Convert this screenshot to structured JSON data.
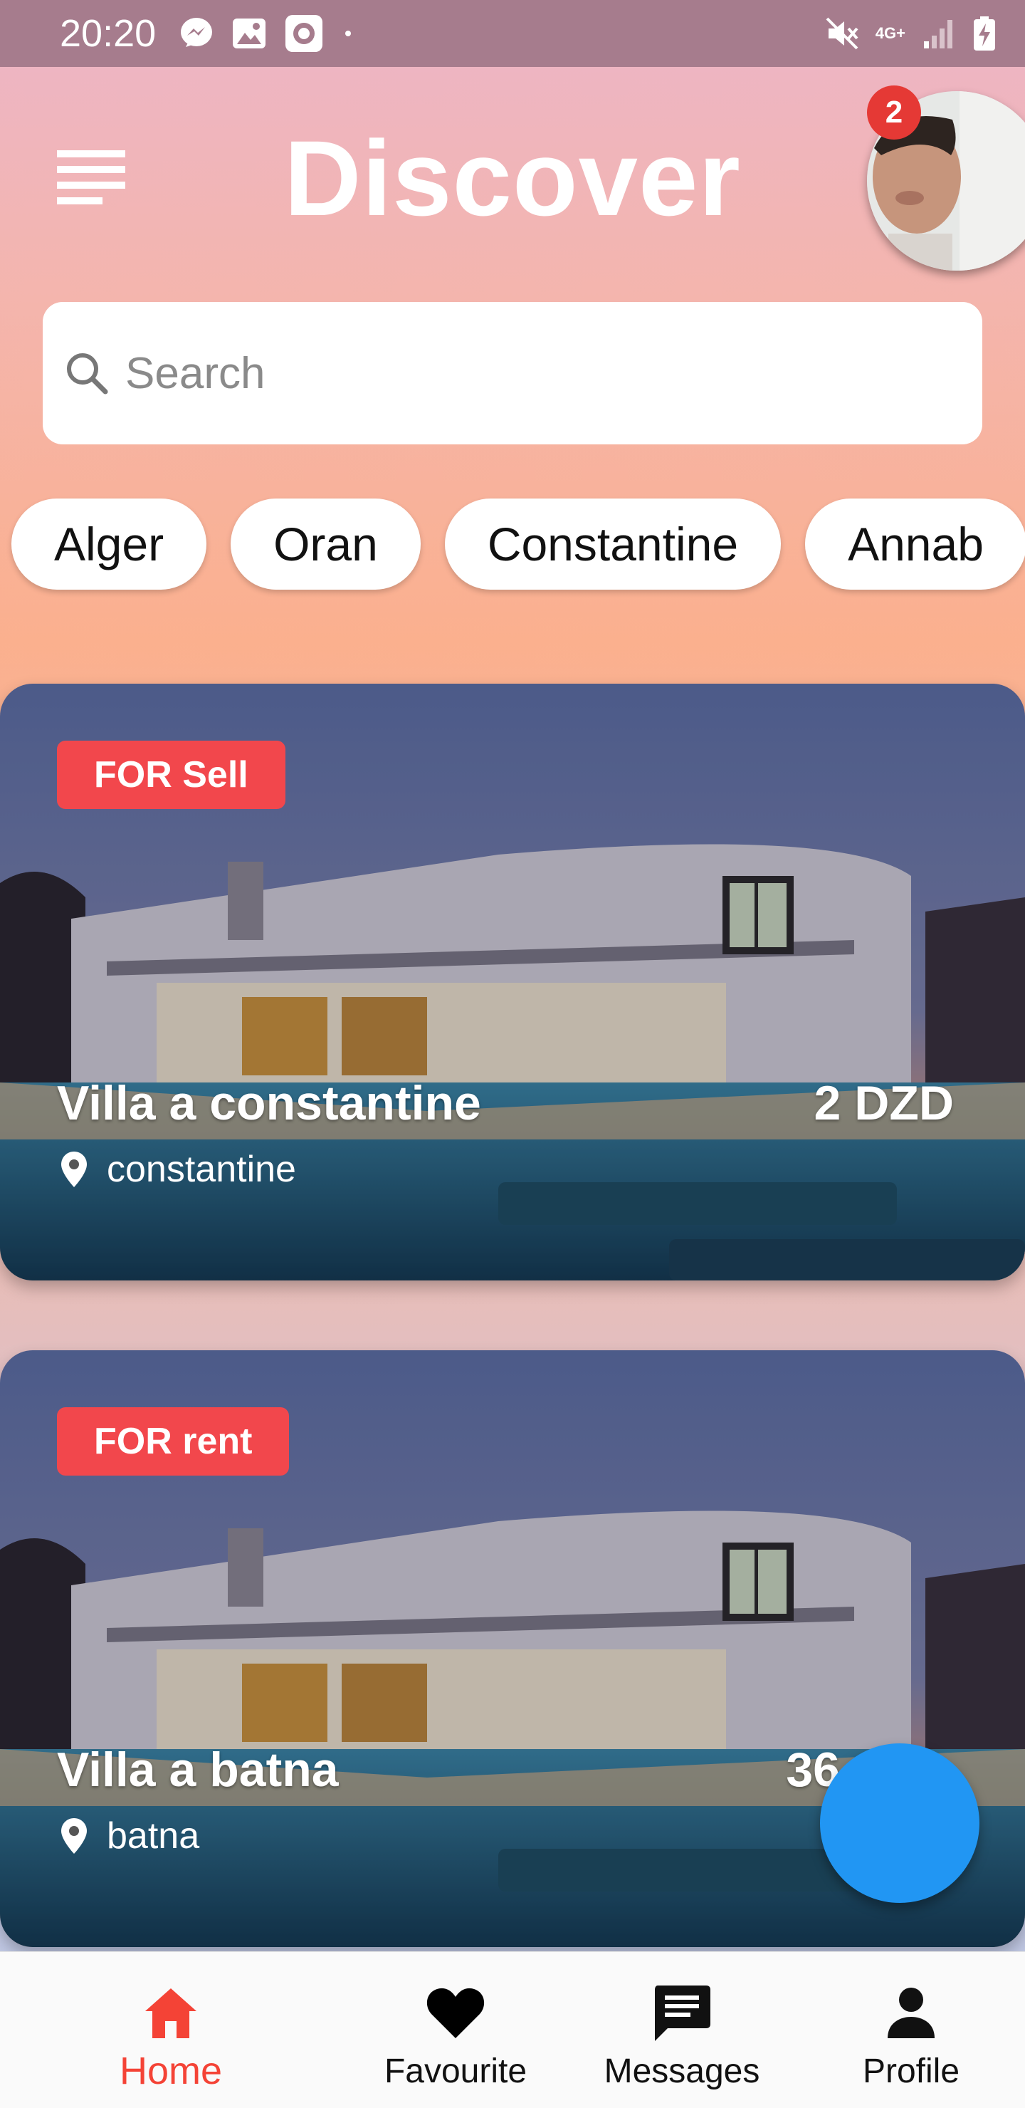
{
  "status_bar": {
    "time": "20:20",
    "network": "4G+"
  },
  "header": {
    "title": "Discover",
    "notification_count": "2"
  },
  "search": {
    "placeholder": "Search"
  },
  "chips": [
    "Alger",
    "Oran",
    "Constantine",
    "Annab"
  ],
  "listings": [
    {
      "tag": "FOR Sell",
      "title": "Villa a constantine",
      "price": "2 DZD",
      "location": "constantine"
    },
    {
      "tag": "FOR rent",
      "title": "Villa a batna",
      "price": "36",
      "location": "batna"
    }
  ],
  "bottom_nav": {
    "items": [
      {
        "label": "Home",
        "icon": "home-icon",
        "active": true
      },
      {
        "label": "Favourite",
        "icon": "heart-icon",
        "active": false
      },
      {
        "label": "Messages",
        "icon": "message-icon",
        "active": false
      },
      {
        "label": "Profile",
        "icon": "person-icon",
        "active": false
      }
    ]
  },
  "colors": {
    "accent": "#f44336",
    "tag": "#f2474c",
    "fab": "#2196f3",
    "status_bar": "#a67c8d"
  }
}
